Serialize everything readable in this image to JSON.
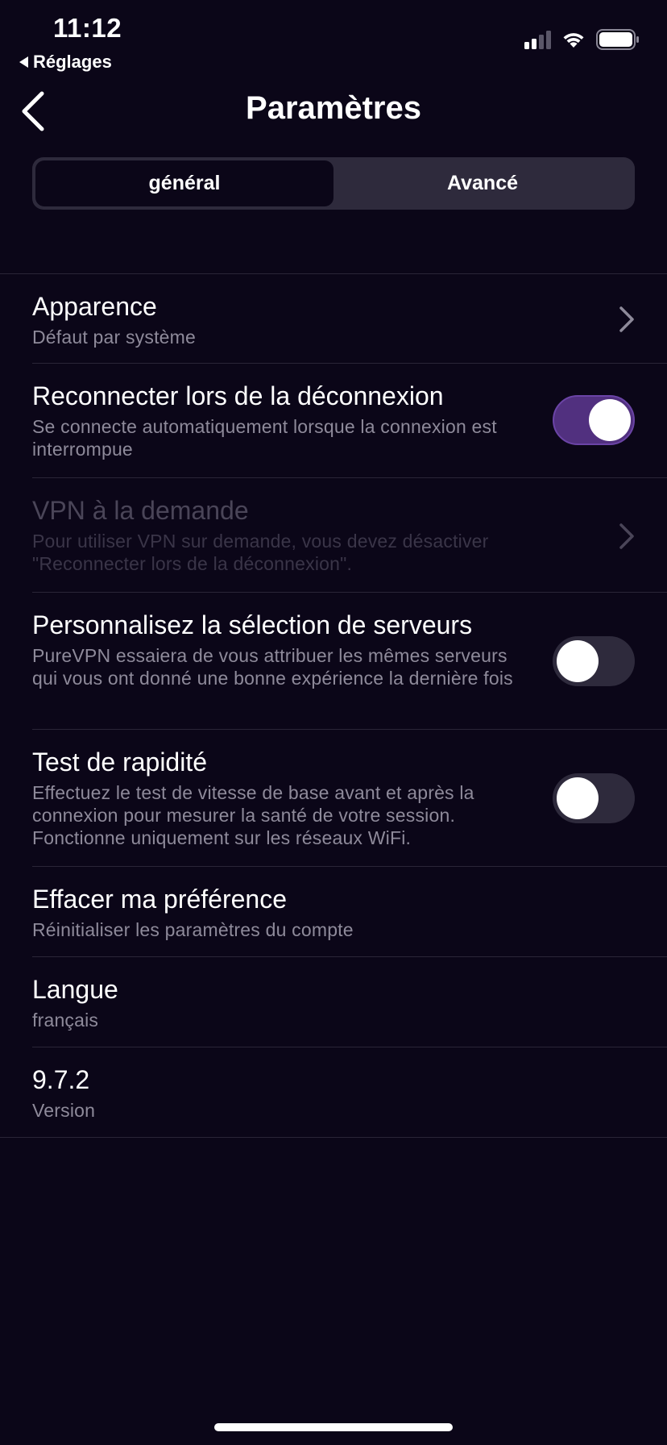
{
  "status_bar": {
    "time": "11:12",
    "back_app": "Réglages"
  },
  "nav": {
    "title": "Paramètres"
  },
  "tabs": [
    {
      "label": "général",
      "selected": true
    },
    {
      "label": "Avancé",
      "selected": false
    }
  ],
  "settings": {
    "appearance": {
      "title": "Apparence",
      "subtitle": "Défaut par système"
    },
    "reconnect": {
      "title": "Reconnecter lors de la déconnexion",
      "subtitle": "Se connecte automatiquement lorsque la connexion est interrompue",
      "enabled": true
    },
    "vpn_on_demand": {
      "title": "VPN à la demande",
      "subtitle": "Pour utiliser VPN sur demande, vous devez désactiver \"Reconnecter lors de la déconnexion\"."
    },
    "server_selection": {
      "title": "Personnalisez la sélection de serveurs",
      "subtitle": "PureVPN essaiera de vous attribuer les mêmes serveurs qui vous ont donné une bonne expérience la dernière fois",
      "enabled": false
    },
    "speed_test": {
      "title": "Test de rapidité",
      "subtitle": "Effectuez le test de vitesse de base avant et après la connexion pour mesurer la santé de votre session. Fonctionne uniquement sur les réseaux WiFi.",
      "enabled": false
    },
    "clear_preference": {
      "title": "Effacer ma préférence",
      "subtitle": "Réinitialiser les paramètres du compte"
    },
    "language": {
      "title": "Langue",
      "subtitle": "français"
    },
    "version": {
      "title": "9.7.2",
      "subtitle": "Version"
    }
  },
  "colors": {
    "background": "#0b0618",
    "toggle_on": "#51307f",
    "toggle_off": "#2e2a3c"
  }
}
